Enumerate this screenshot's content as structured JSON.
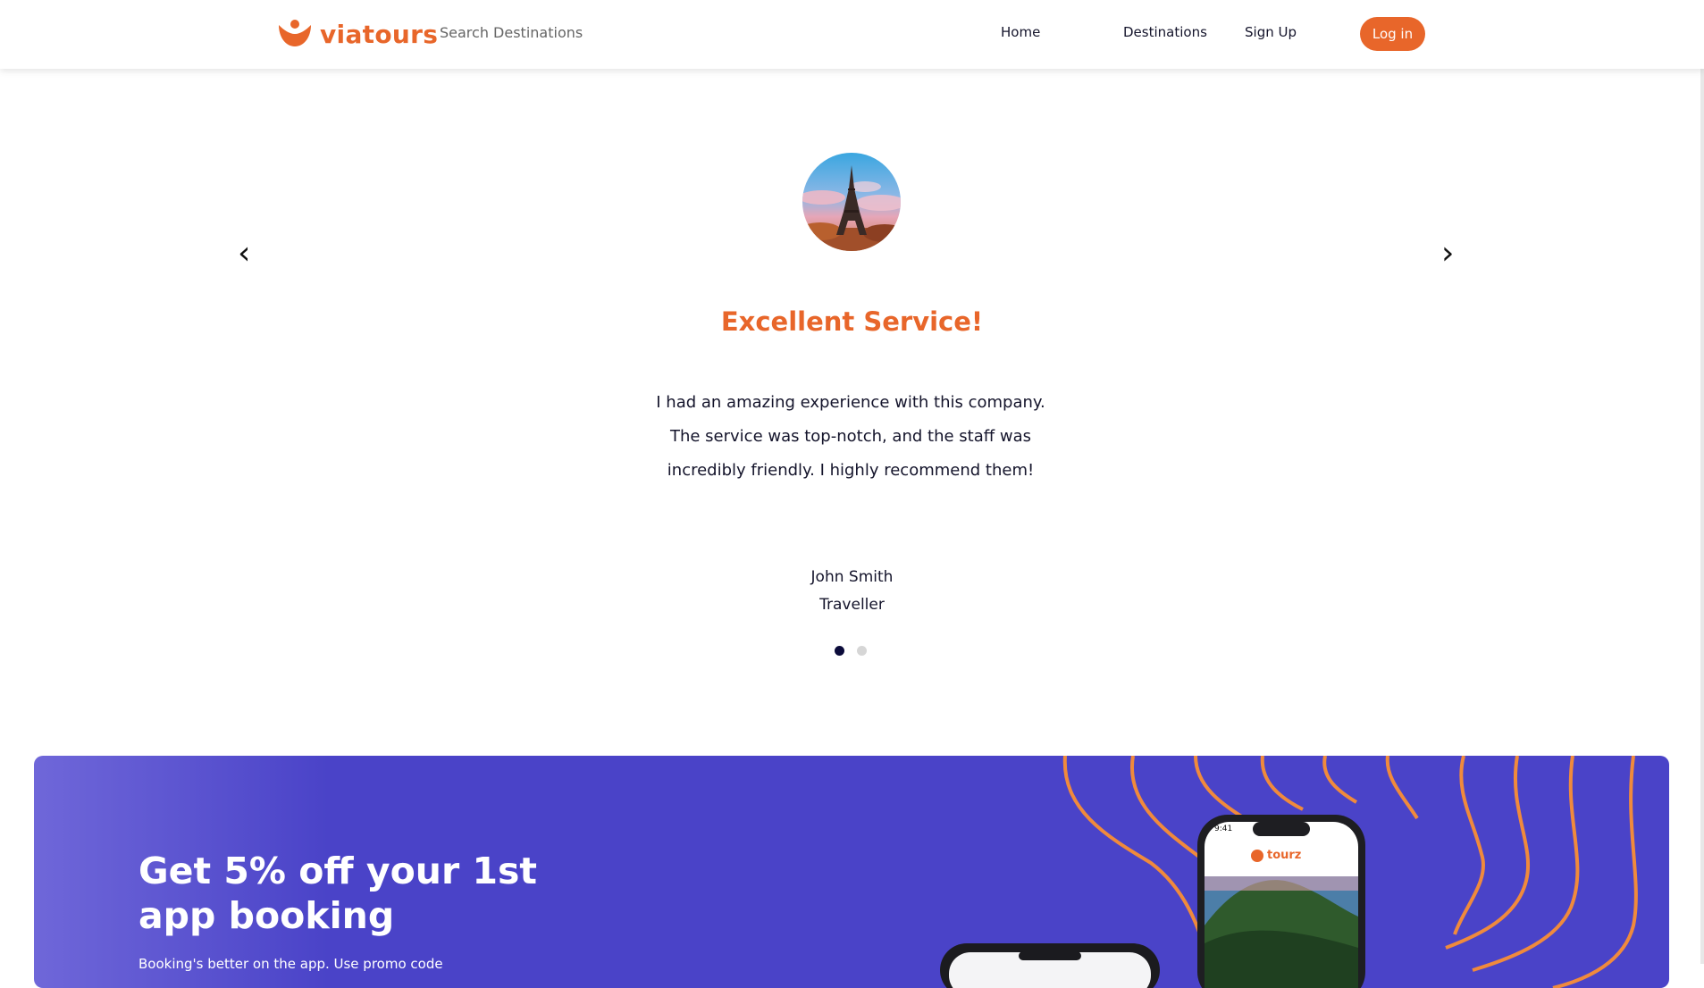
{
  "brand": {
    "name": "viatours",
    "accent": "#e8662a"
  },
  "search": {
    "placeholder": "Search Destinations"
  },
  "nav": {
    "home": "Home",
    "destinations": "Destinations",
    "signup": "Sign Up",
    "login": "Log in"
  },
  "testimonial": {
    "prev_icon": "chevron-left-icon",
    "next_icon": "chevron-right-icon",
    "title": "Excellent Service!",
    "body": "I had an amazing experience with this company. The service was top-notch, and the staff was incredibly friendly. I highly recommend them!",
    "name": "John Smith",
    "role": "Traveller",
    "slide_count": 2,
    "active_slide": 1
  },
  "promo": {
    "title": "Get 5% off your 1st app booking",
    "subtitle": "Booking's better on the app. Use promo code",
    "phone_brand": "tourz",
    "phone_time": "9:41",
    "background": "#4a43c8"
  }
}
